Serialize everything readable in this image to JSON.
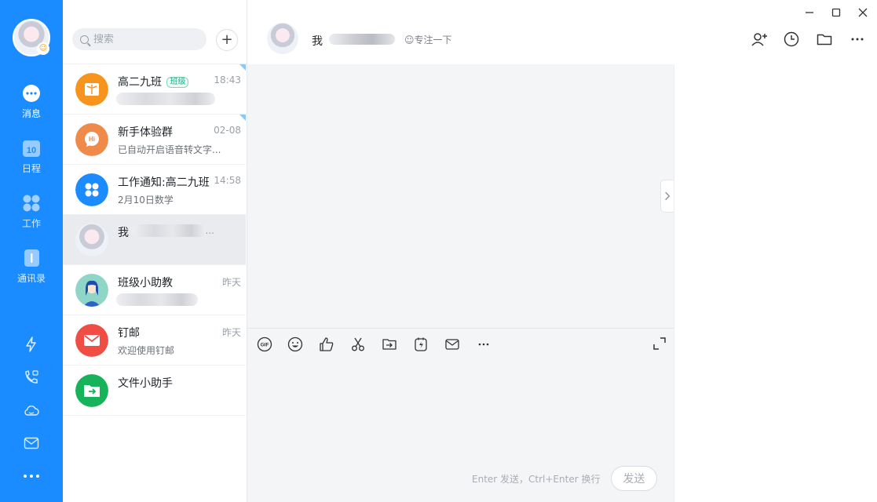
{
  "rail": {
    "items": [
      {
        "label": "消息",
        "icon": "chat-bubble-icon"
      },
      {
        "label": "日程",
        "icon": "calendar-icon",
        "day": "10"
      },
      {
        "label": "工作",
        "icon": "apps-grid-icon"
      },
      {
        "label": "通讯录",
        "icon": "contacts-book-icon"
      }
    ],
    "bottom_icons": [
      "lightning-icon",
      "phone-video-icon",
      "cloud-icon",
      "mail-icon",
      "more-dots-icon"
    ]
  },
  "search": {
    "placeholder": "搜索"
  },
  "conversations": [
    {
      "name": "高二九班",
      "tag": "班级",
      "time": "18:43",
      "preview": "",
      "avatar_color": "#f7941d"
    },
    {
      "name": "新手体验群",
      "time": "02-08",
      "preview": "已自动开启语音转文字...",
      "avatar_color": "#f08a4b"
    },
    {
      "name": "工作通知:高二九班",
      "time": "14:58",
      "preview": "2月10日数学",
      "avatar_color": "#1a8cff"
    },
    {
      "name": "我",
      "time": "...",
      "preview": ""
    },
    {
      "name": "班级小助教",
      "time": "昨天",
      "preview": ""
    },
    {
      "name": "钉邮",
      "time": "昨天",
      "preview": "欢迎使用钉邮",
      "avatar_color": "#f04e45"
    },
    {
      "name": "文件小助手",
      "time": "",
      "preview": "",
      "avatar_color": "#16b35a"
    }
  ],
  "chat": {
    "title": "我",
    "status": "专注一下",
    "header_tools": [
      "add-member-icon",
      "history-clock-icon",
      "folder-icon",
      "more-icon"
    ],
    "composer_tools": [
      "gif-icon",
      "emoji-icon",
      "thumbs-up-icon",
      "scissors-icon",
      "forward-icon",
      "flash-note-icon",
      "mail-icon",
      "more-icon"
    ],
    "hint": "Enter 发送，Ctrl+Enter 换行",
    "send_label": "发送"
  }
}
